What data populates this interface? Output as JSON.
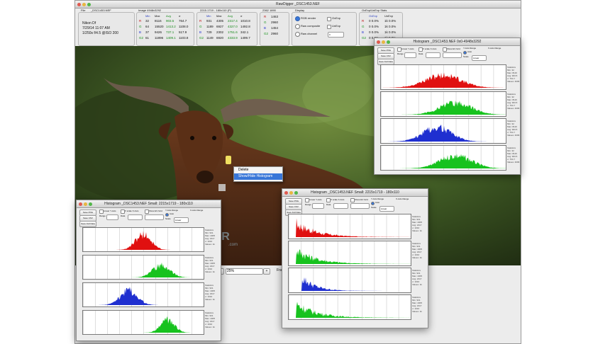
{
  "colors": {
    "red": "#e01010",
    "green": "#17c21e",
    "blue": "#1f2fd0",
    "menu_bg": "#ececec",
    "selected": "#3876d8"
  },
  "main": {
    "title": "RawDigger _DSC1453.NEF",
    "file": {
      "label": "File",
      "name": "_DSC1453.NEF",
      "camera": "Nikon Df",
      "date": "7/29/14 11:07 AM",
      "exposure": "1/250s f/4.5 @ISO 200"
    },
    "image": {
      "label": "Image 4948x3292",
      "headers": [
        "",
        "Min",
        "Max",
        "Avg",
        "σ"
      ],
      "rows": [
        [
          "R",
          "32",
          "8116",
          "903.5",
          "764.7"
        ],
        [
          "G",
          "64",
          "15520",
          "1413.2",
          "1108.0"
        ],
        [
          "B",
          "37",
          "9426",
          "737.1",
          "517.9"
        ],
        [
          "G2",
          "61",
          "11896",
          "1409.1",
          "1103.8"
        ]
      ]
    },
    "selection": {
      "label": "2215.1719 - 180x110 (P)",
      "headers": [
        "",
        "Min",
        "Max",
        "Avg",
        "σ"
      ],
      "rows": [
        [
          "R",
          "931",
          "4305",
          "2317.4",
          "1010.8"
        ],
        [
          "G",
          "1189",
          "6927",
          "4327.0",
          "1492.8"
        ],
        [
          "B",
          "729",
          "2302",
          "1751.6",
          "342.1"
        ],
        [
          "G2",
          "1149",
          "6920",
          "4333.9",
          "1499.7"
        ]
      ]
    },
    "pixel": {
      "label": "2362 1890",
      "rows": [
        [
          "R",
          "1463"
        ],
        [
          "G",
          "2960"
        ],
        [
          "B",
          "1454"
        ],
        [
          "G2",
          "2960"
        ]
      ]
    },
    "display": {
      "label": "Display",
      "options": [
        "RGB render",
        "Raw composite",
        "Raw channel"
      ],
      "checks": [
        "OvExp",
        "UnExp"
      ],
      "channel_value": "0"
    },
    "overexp": {
      "label": "OvExp/UnExp Stats",
      "headers": [
        "",
        "OvExp",
        "UnExp"
      ],
      "rows": [
        [
          "R",
          "0 0.0%",
          "1k 0.0%"
        ],
        [
          "G",
          "0 0.0%",
          "1k 0.0%"
        ],
        [
          "B",
          "0 0.0%",
          "1k 0.0%"
        ],
        [
          "G2",
          "0 0.0%",
          "1k 0.0%"
        ]
      ]
    },
    "zoom": "25%",
    "zoom_trailing": "Fra"
  },
  "context_menu": {
    "items": [
      "Delete",
      "Show/Hide Histogram"
    ]
  },
  "histograms": [
    {
      "title": "Histogram _DSC1453.NEF 0x0-4948x3292",
      "controls": {
        "linear_y": "Linear Y-Axis",
        "show_grid": "Show EV Grid",
        "x_scale": "X scale X-Axis",
        "y_axis_range": "Y-Axis Range",
        "x_axis_range": "X-Axis Range",
        "scale": "Scale",
        "data": "Data",
        "auto": "Auto",
        "linear": "Linear",
        "buttons": [
          "Save PNG",
          "Save CSV",
          "Save Full Data"
        ],
        "range": "Range"
      },
      "stats": [
        "Statistics",
        "Min: 32",
        "Max: 8116",
        "Avg: 903.5",
        "σ: 764.7",
        "Values: 4096"
      ],
      "channels": [
        "red",
        "green",
        "blue",
        "green"
      ]
    },
    {
      "title": "Histogram _DSC1453.NEF Small: 2215x1719 - 180x110",
      "controls": {
        "linear_y": "Linear Y-Axis",
        "show_grid": "Show EV Grid",
        "x_scale": "X scale X-Axis",
        "y_axis_range": "Y-Axis Range",
        "x_axis_range": "X-Axis Range",
        "scale": "Scale",
        "data": "Data",
        "auto": "Auto",
        "linear": "Linear",
        "buttons": [
          "Save PNG",
          "Save CSV",
          "Save Full Data"
        ],
        "range": "Range"
      },
      "stats": [
        "Statistics",
        "Min: 931",
        "Max: 4305",
        "Avg: 2317",
        "σ: 1010",
        "Values: 1k"
      ],
      "channels": [
        "red",
        "green",
        "blue",
        "green"
      ]
    },
    {
      "title": "Histogram _DSC1453.NEF Small: 2215x1719 - 180x110",
      "controls": {
        "linear_y": "Linear Y-Axis",
        "show_grid": "Show EV Grid",
        "x_scale": "X scale X-Axis",
        "y_axis_range": "Y-Axis Range",
        "x_axis_range": "X-Axis Range",
        "scale": "Scale",
        "data": "Data",
        "auto": "Auto",
        "linear": "Linear",
        "buttons": [
          "Save PNG",
          "Save CSV",
          "Save Full Data"
        ],
        "range": "Range"
      },
      "stats": [
        "Statistics",
        "Min: 931",
        "Max: 4305",
        "Avg: 2317",
        "σ: 1010",
        "Values: 1k"
      ],
      "channels": [
        "red",
        "green",
        "blue",
        "green"
      ]
    }
  ],
  "watermark": "FILECR",
  "watermark_sub": ".com"
}
